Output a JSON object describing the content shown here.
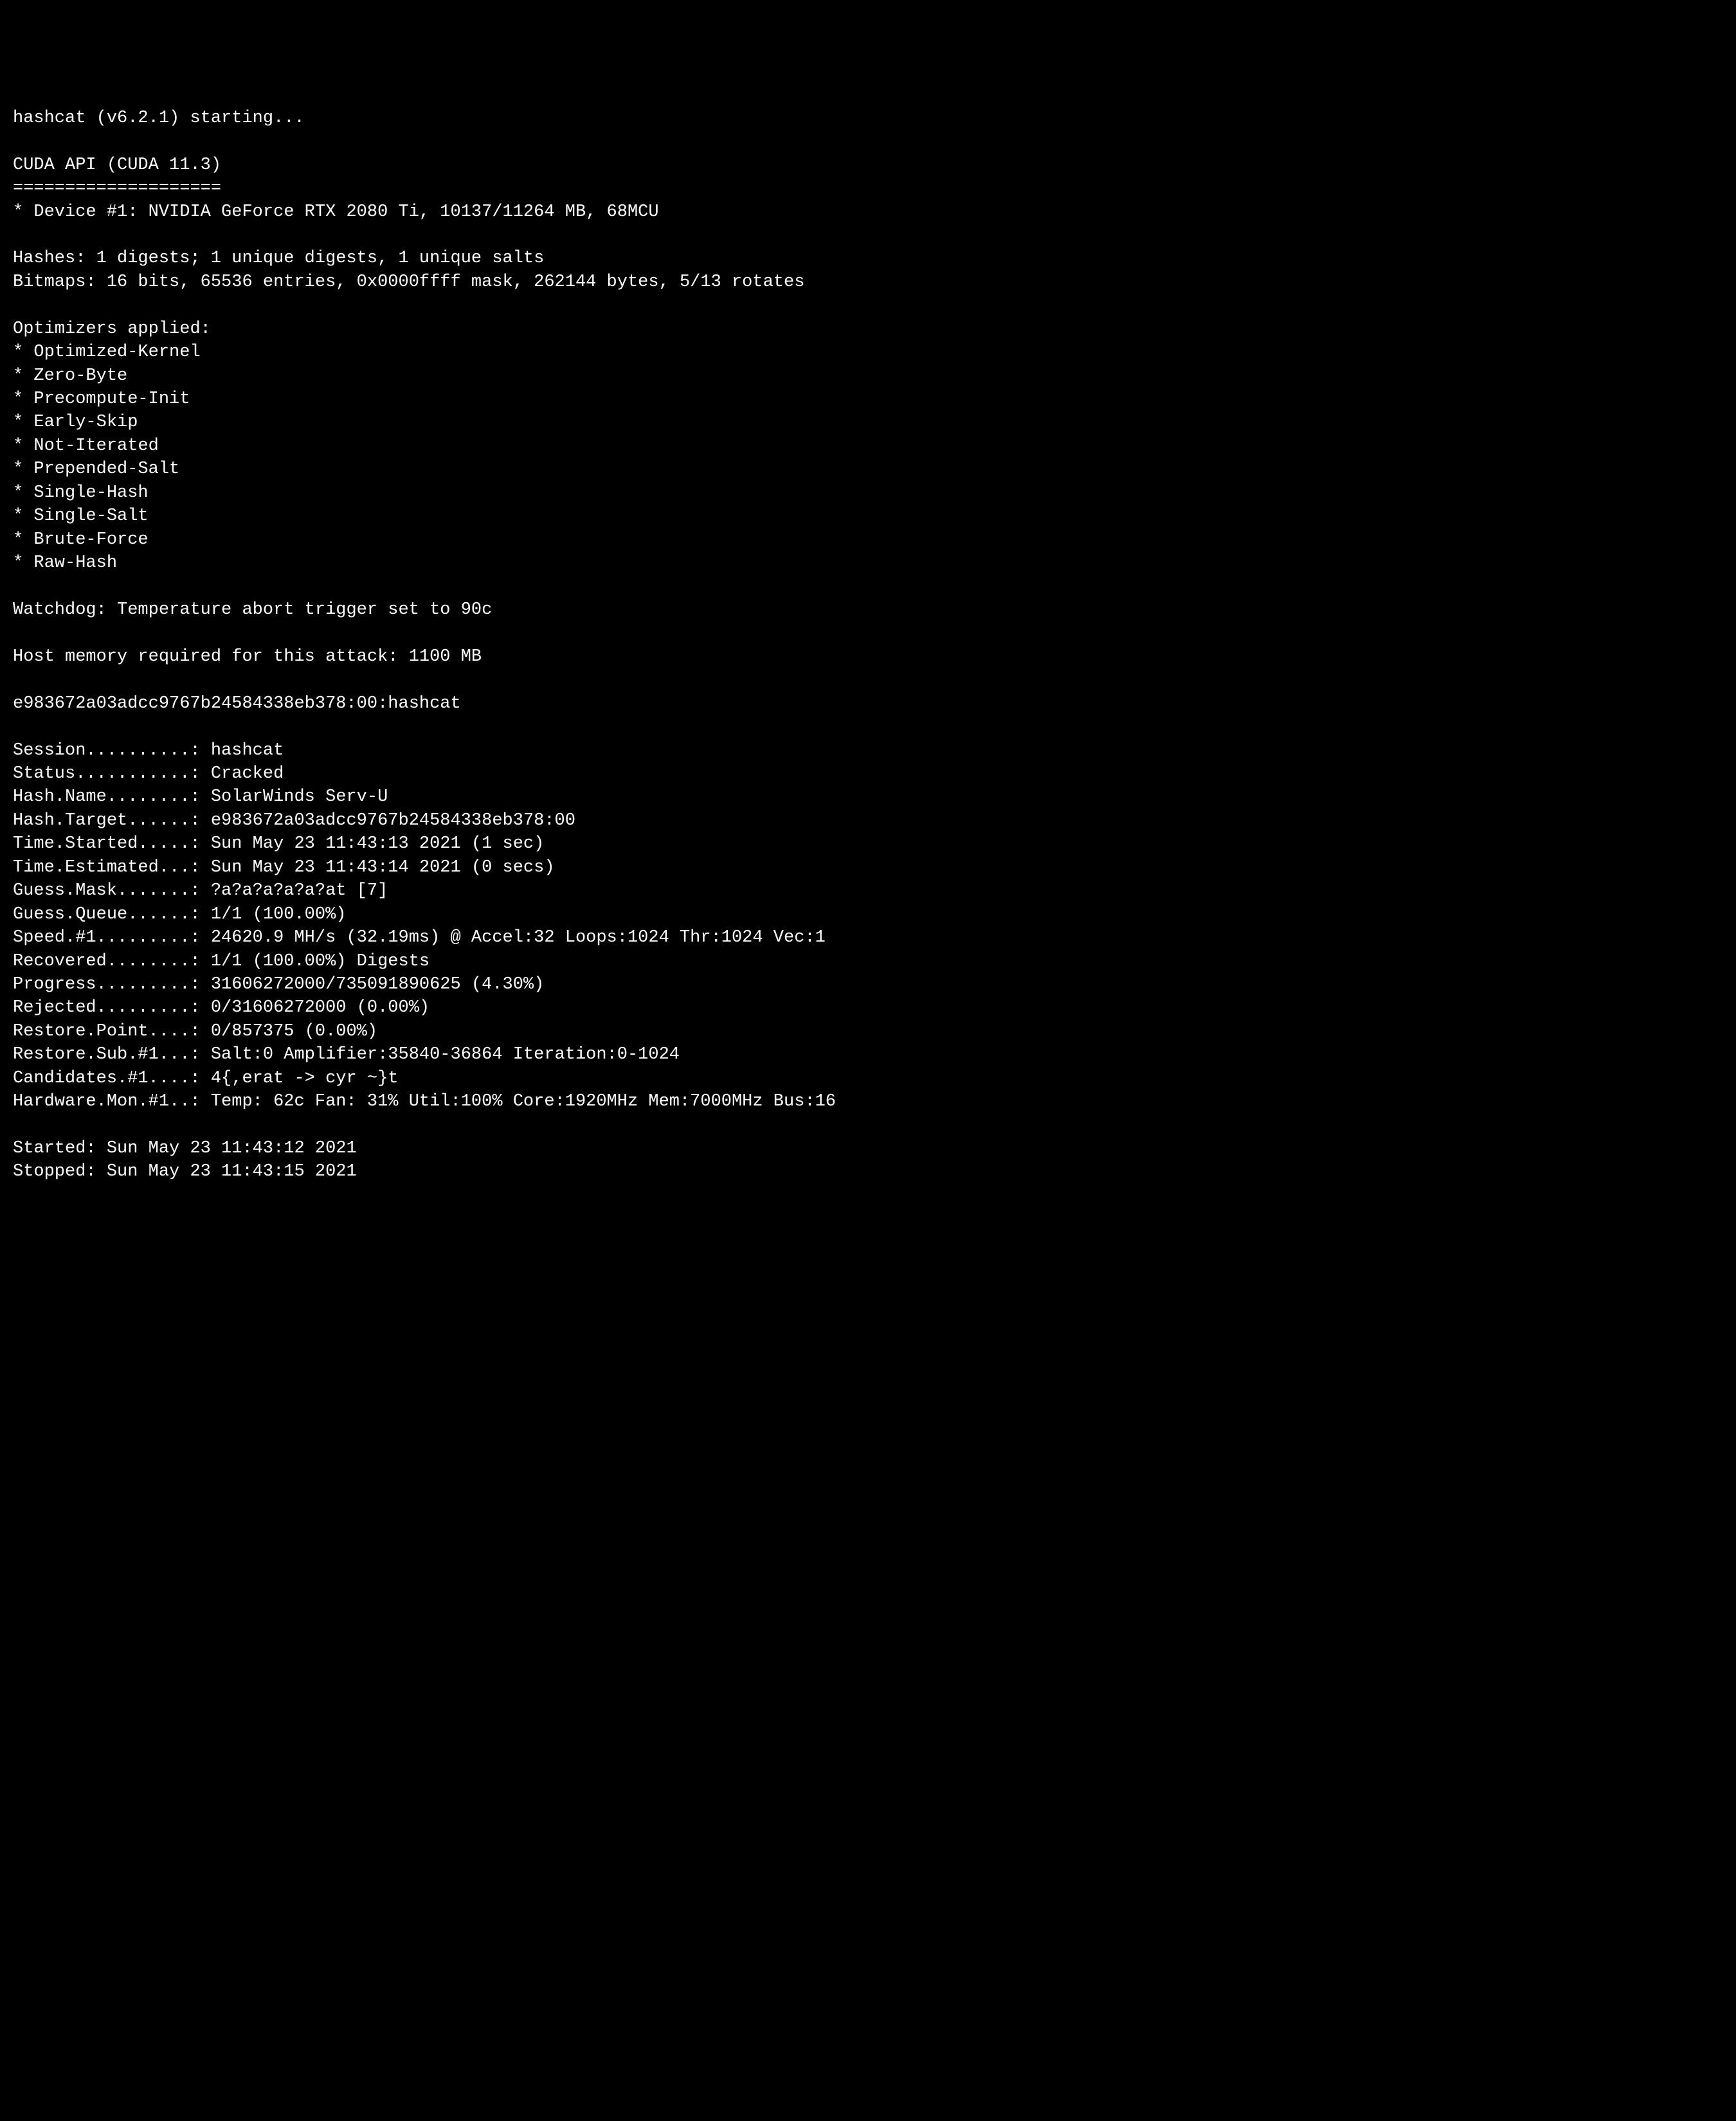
{
  "header": {
    "starting": "hashcat (v6.2.1) starting..."
  },
  "cuda": {
    "title": "CUDA API (CUDA 11.3)",
    "separator": "====================",
    "device": "* Device #1: NVIDIA GeForce RTX 2080 Ti, 10137/11264 MB, 68MCU"
  },
  "hashes": "Hashes: 1 digests; 1 unique digests, 1 unique salts",
  "bitmaps": "Bitmaps: 16 bits, 65536 entries, 0x0000ffff mask, 262144 bytes, 5/13 rotates",
  "optimizers": {
    "title": "Optimizers applied:",
    "items": [
      "* Optimized-Kernel",
      "* Zero-Byte",
      "* Precompute-Init",
      "* Early-Skip",
      "* Not-Iterated",
      "* Prepended-Salt",
      "* Single-Hash",
      "* Single-Salt",
      "* Brute-Force",
      "* Raw-Hash"
    ]
  },
  "watchdog": "Watchdog: Temperature abort trigger set to 90c",
  "hostmem": "Host memory required for this attack: 1100 MB",
  "cracked_line": "e983672a03adcc9767b24584338eb378:00:hashcat",
  "status": {
    "session": "Session..........: hashcat",
    "status": "Status...........: Cracked",
    "hash_name": "Hash.Name........: SolarWinds Serv-U",
    "hash_target": "Hash.Target......: e983672a03adcc9767b24584338eb378:00",
    "time_started": "Time.Started.....: Sun May 23 11:43:13 2021 (1 sec)",
    "time_estimated": "Time.Estimated...: Sun May 23 11:43:14 2021 (0 secs)",
    "guess_mask": "Guess.Mask.......: ?a?a?a?a?a?at [7]",
    "guess_queue": "Guess.Queue......: 1/1 (100.00%)",
    "speed": "Speed.#1.........: 24620.9 MH/s (32.19ms) @ Accel:32 Loops:1024 Thr:1024 Vec:1",
    "recovered": "Recovered........: 1/1 (100.00%) Digests",
    "progress": "Progress.........: 31606272000/735091890625 (4.30%)",
    "rejected": "Rejected.........: 0/31606272000 (0.00%)",
    "restore_point": "Restore.Point....: 0/857375 (0.00%)",
    "restore_sub": "Restore.Sub.#1...: Salt:0 Amplifier:35840-36864 Iteration:0-1024",
    "candidates": "Candidates.#1....: 4{,erat -> cyr ~}t",
    "hardware_mon": "Hardware.Mon.#1..: Temp: 62c Fan: 31% Util:100% Core:1920MHz Mem:7000MHz Bus:16"
  },
  "footer": {
    "started": "Started: Sun May 23 11:43:12 2021",
    "stopped": "Stopped: Sun May 23 11:43:15 2021"
  }
}
